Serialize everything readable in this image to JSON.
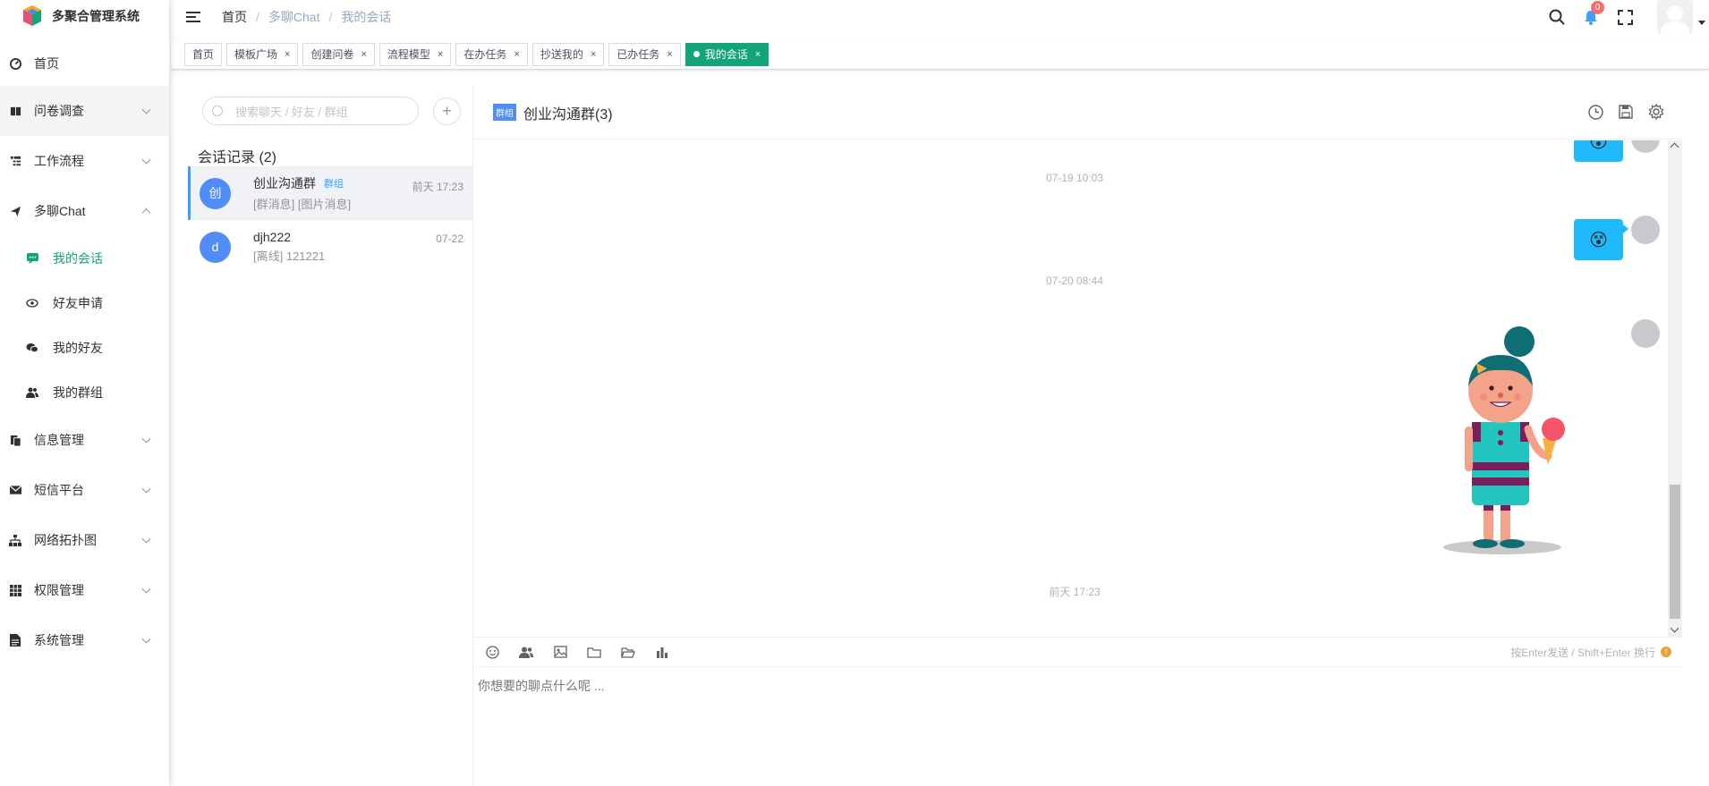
{
  "app": {
    "title": "多聚合管理系统"
  },
  "sidebar": {
    "items": [
      {
        "label": "首页"
      },
      {
        "label": "问卷调查"
      },
      {
        "label": "工作流程"
      },
      {
        "label": "多聊Chat"
      },
      {
        "label": "信息管理"
      },
      {
        "label": "短信平台"
      },
      {
        "label": "网络拓扑图"
      },
      {
        "label": "权限管理"
      },
      {
        "label": "系统管理"
      }
    ],
    "chat_sub": [
      {
        "label": "我的会话"
      },
      {
        "label": "好友申请"
      },
      {
        "label": "我的好友"
      },
      {
        "label": "我的群组"
      }
    ]
  },
  "header": {
    "breadcrumb": [
      "首页",
      "多聊Chat",
      "我的会话"
    ],
    "notification_count": "0"
  },
  "tags": [
    {
      "label": "首页"
    },
    {
      "label": "模板广场"
    },
    {
      "label": "创建问卷"
    },
    {
      "label": "流程模型"
    },
    {
      "label": "在办任务"
    },
    {
      "label": "抄送我的"
    },
    {
      "label": "已办任务"
    },
    {
      "label": "我的会话"
    }
  ],
  "chat_list": {
    "search_placeholder": "搜索聊天 / 好友 / 群组",
    "title": "会话记录 (2)",
    "conversations": [
      {
        "avatar": "创",
        "name": "创业沟通群",
        "tag": "群组",
        "preview": "[群消息] [图片消息]",
        "time": "前天 17:23"
      },
      {
        "avatar": "d",
        "name": "djh222",
        "tag": "",
        "preview": "[离线]  121221",
        "time": "07-22"
      }
    ]
  },
  "chat": {
    "group_badge": "群组",
    "title": "创业沟通群(3)",
    "timestamps": [
      "07-19 10:03",
      "07-20 08:44",
      "前天 17:23"
    ],
    "emoji": "😵",
    "input_placeholder": "你想要的聊点什么呢 ...",
    "hint": "按Enter发送 / Shift+Enter 换行"
  },
  "colors": {
    "accent": "#13a579",
    "bubble": "#1ebafc",
    "avatar": "#508df8"
  }
}
